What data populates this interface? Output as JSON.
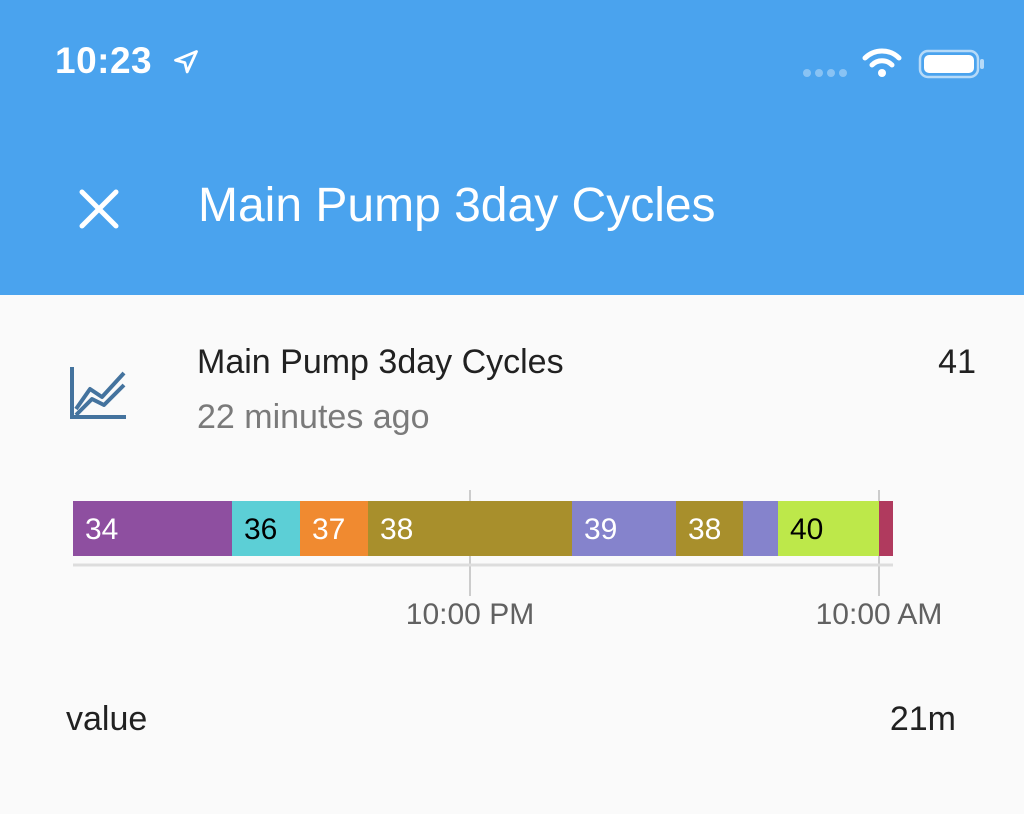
{
  "status_bar": {
    "time": "10:23",
    "icons": [
      "location-arrow-icon",
      "cellular-signal-icon",
      "wifi-icon",
      "battery-icon"
    ]
  },
  "header": {
    "close_icon": "close-icon",
    "title": "Main Pump 3day Cycles"
  },
  "entity": {
    "icon": "chart-line-icon",
    "name": "Main Pump 3day Cycles",
    "last_changed": "22 minutes ago",
    "state": "41"
  },
  "chart_data": {
    "type": "timeline",
    "x_ticks": [
      "10:00 PM",
      "10:00 AM"
    ],
    "segments": [
      {
        "label": "34",
        "color": "#8e4fa0",
        "text_color": "#ffffff"
      },
      {
        "label": "36",
        "color": "#5ccfd6",
        "text_color": "#000000"
      },
      {
        "label": "37",
        "color": "#f08a30",
        "text_color": "#ffffff"
      },
      {
        "label": "38",
        "color": "#a88f2c",
        "text_color": "#ffffff"
      },
      {
        "label": "39",
        "color": "#8583cc",
        "text_color": "#ffffff"
      },
      {
        "label": "38",
        "color": "#a88f2c",
        "text_color": "#ffffff"
      },
      {
        "label": "",
        "color": "#8583cc",
        "text_color": "#ffffff"
      },
      {
        "label": "40",
        "color": "#bde84a",
        "text_color": "#000000"
      },
      {
        "label": "",
        "color": "#b03a5e",
        "text_color": "#ffffff"
      }
    ]
  },
  "attributes": [
    {
      "label": "value",
      "value": "21m"
    }
  ],
  "colors": {
    "header": "#4aa3ee",
    "background": "#fafafa",
    "icon": "#44739e"
  }
}
